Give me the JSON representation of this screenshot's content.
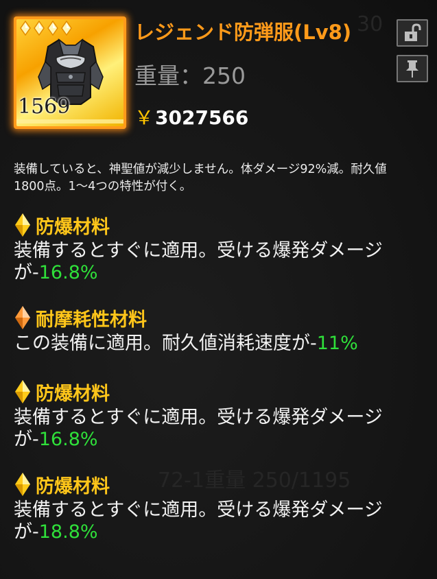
{
  "background_ghost": {
    "top_right": "30",
    "lower": "72-1重量 250/1195"
  },
  "item": {
    "name": "レジェンド防弾服(Lv8)",
    "stars": 4,
    "count": "1569",
    "icon": "body-armor-icon",
    "weight_label": "重量：250",
    "price_symbol": "￥",
    "price_value": "3027566"
  },
  "buttons": {
    "lock": "unlock-icon",
    "pin": "pin-icon"
  },
  "description": "装備していると、神聖値が減少しません。体ダメージ92%減。耐久値1800点。1～4つの特性が付く。",
  "traits": [
    {
      "icon": "yellow-diamond-icon",
      "title": "防爆材料",
      "text": "装備するとすぐに適用。受ける爆発ダメージが-",
      "value": "16.8%"
    },
    {
      "icon": "orange-diamond-icon",
      "title": "耐摩耗性材料",
      "text": "この装備に適用。耐久値消耗速度が-",
      "value": "11%"
    },
    {
      "icon": "yellow-diamond-icon",
      "title": "防爆材料",
      "text": "装備するとすぐに適用。受ける爆発ダメージが-",
      "value": "16.8%"
    },
    {
      "icon": "yellow-diamond-icon",
      "title": "防爆材料",
      "text": "装備するとすぐに適用。受ける爆発ダメージが-",
      "value": "18.8%"
    }
  ],
  "colors": {
    "name": "#ff9a1a",
    "trait_title": "#ffc61a",
    "value_green": "#2fe03a",
    "price_yen": "#ffc400"
  }
}
